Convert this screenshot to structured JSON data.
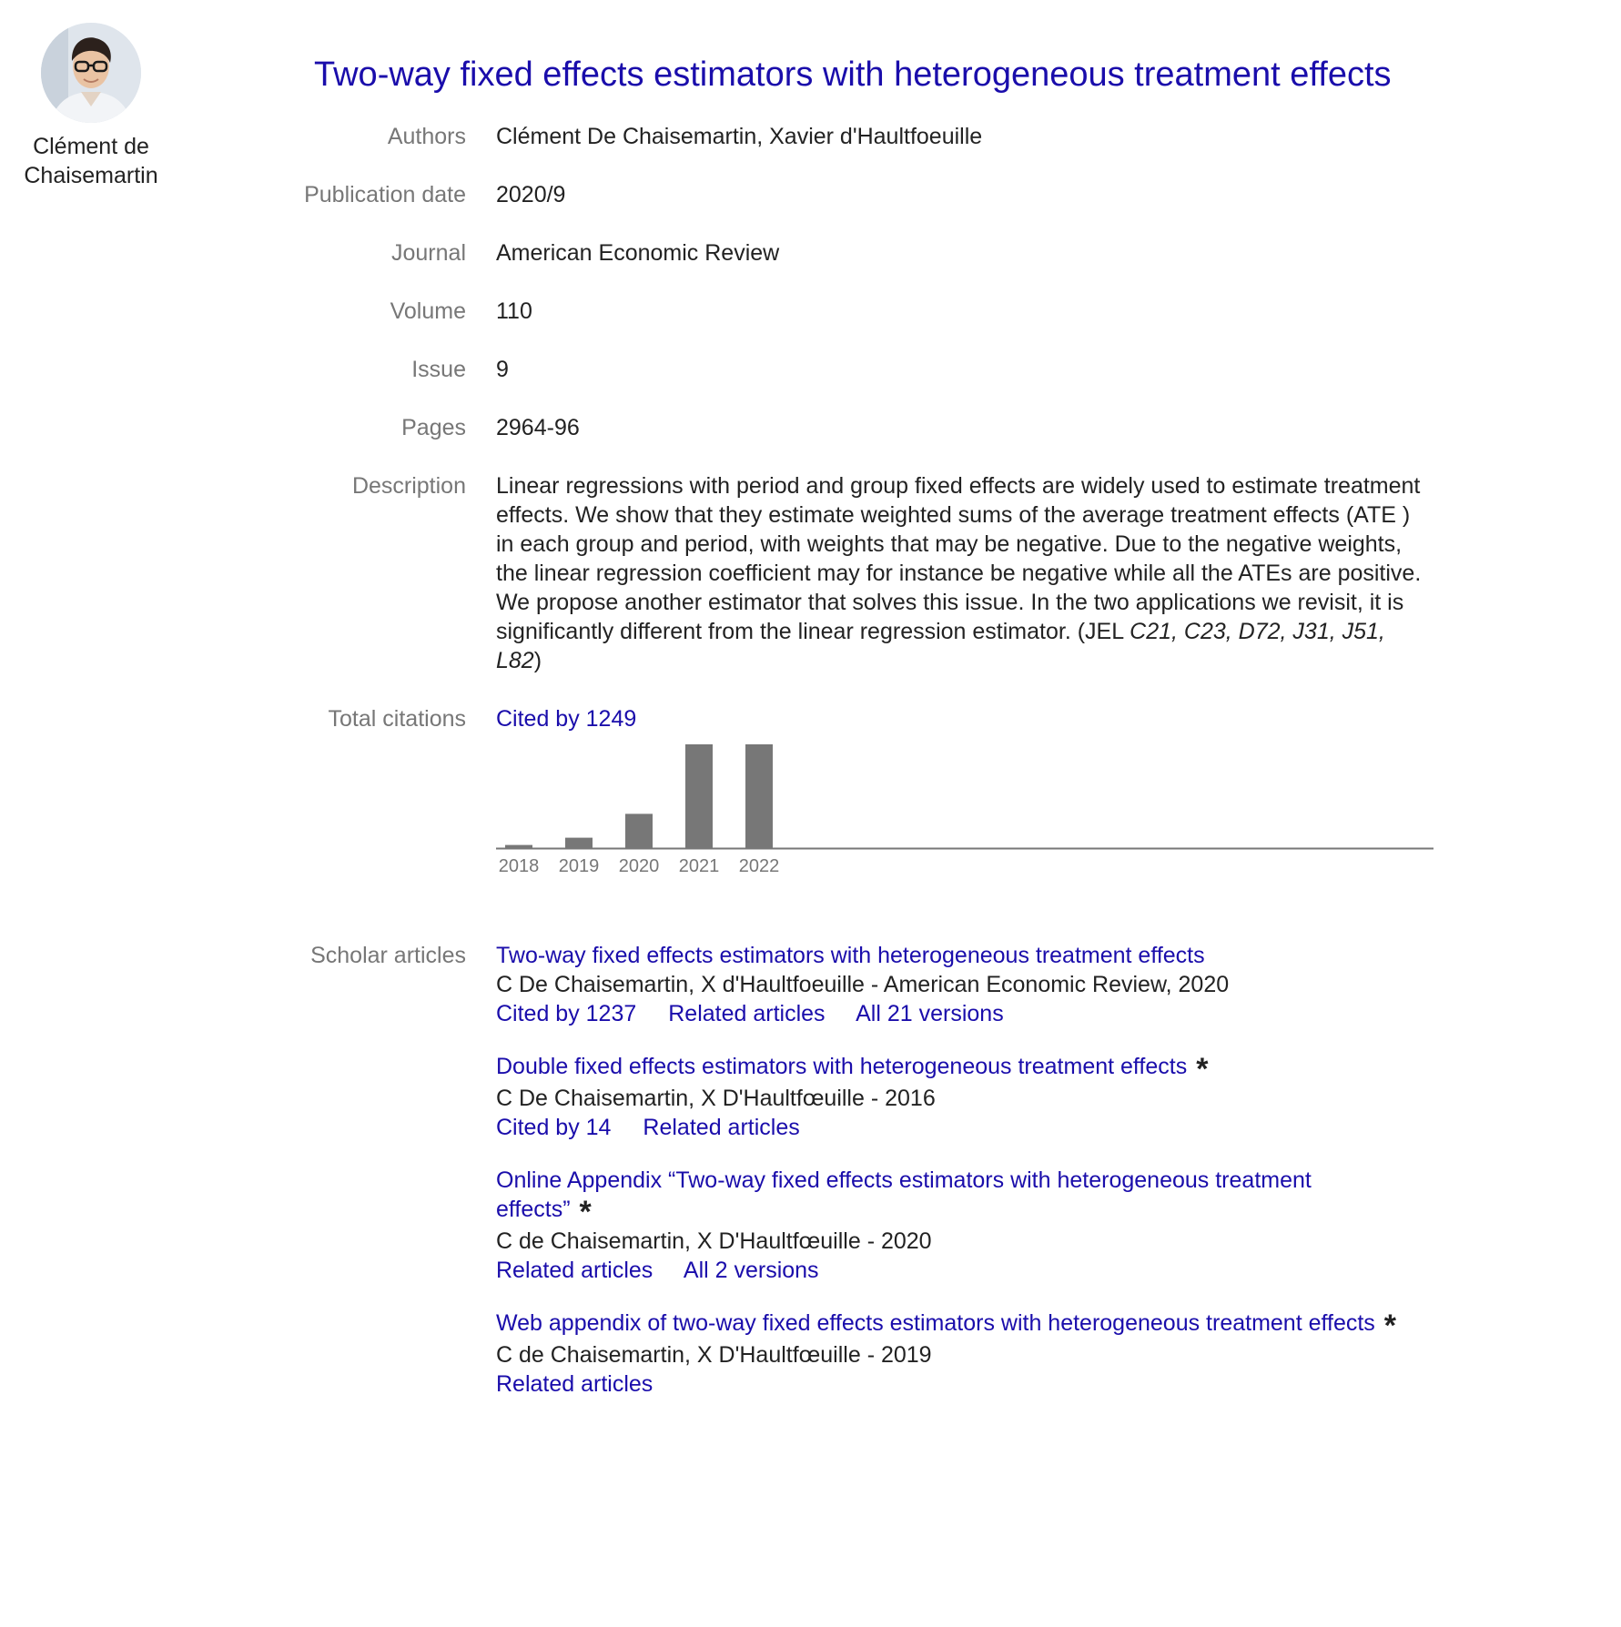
{
  "profile": {
    "name_line1": "Clément de",
    "name_line2": "Chaisemartin"
  },
  "title": "Two-way fixed effects estimators with heterogeneous treatment effects",
  "fields": {
    "authors": {
      "label": "Authors",
      "value": "Clément De Chaisemartin, Xavier d'Haultfoeuille"
    },
    "publication_date": {
      "label": "Publication date",
      "value": "2020/9"
    },
    "journal": {
      "label": "Journal",
      "value": "American Economic Review"
    },
    "volume": {
      "label": "Volume",
      "value": "110"
    },
    "issue": {
      "label": "Issue",
      "value": "9"
    },
    "pages": {
      "label": "Pages",
      "value": "2964-96"
    },
    "description": {
      "label": "Description",
      "text": "Linear regressions with period and group fixed effects are widely used to estimate treatment effects. We show that they estimate weighted sums of the average treatment effects (ATE ) in each group and period, with weights that may be negative. Due to the negative weights, the linear regression coefficient may for instance be negative while all the ATEs are positive. We propose another estimator that solves this issue. In the two applications we revisit, it is significantly different from the linear regression estimator.",
      "jel_open": "(JEL ",
      "jel_codes": "C21, C23, D72, J31, J51, L82",
      "jel_close": ")"
    },
    "total_citations": {
      "label": "Total citations",
      "link": "Cited by 1249"
    },
    "scholar_articles": {
      "label": "Scholar articles"
    }
  },
  "chart_data": {
    "type": "bar",
    "categories": [
      "2018",
      "2019",
      "2020",
      "2021",
      "2022"
    ],
    "values": [
      3,
      10,
      33,
      100,
      100
    ],
    "ylim": [
      0,
      100
    ],
    "bar_color": "#777777",
    "axis_color": "#777777"
  },
  "articles": [
    {
      "title": "Two-way fixed effects estimators with heterogeneous treatment effects",
      "star": "",
      "meta": "C De Chaisemartin, X d'Haultfoeuille - American Economic Review, 2020",
      "links": [
        "Cited by 1237",
        "Related articles",
        "All 21 versions"
      ]
    },
    {
      "title": "Double fixed effects estimators with heterogeneous treatment effects",
      "star": "*",
      "meta": "C De Chaisemartin, X D'Haultfœuille - 2016",
      "links": [
        "Cited by 14",
        "Related articles"
      ]
    },
    {
      "title": "Online Appendix “Two-way fixed effects estimators with heterogeneous treatment effects”",
      "star": "*",
      "meta": "C de Chaisemartin, X D'Haultfœuille - 2020",
      "links": [
        "Related articles",
        "All 2 versions"
      ]
    },
    {
      "title": "Web appendix of two-way fixed effects estimators with heterogeneous treatment effects",
      "star": "*",
      "meta": "C de Chaisemartin, X D'Haultfœuille - 2019",
      "links": [
        "Related articles"
      ]
    }
  ]
}
